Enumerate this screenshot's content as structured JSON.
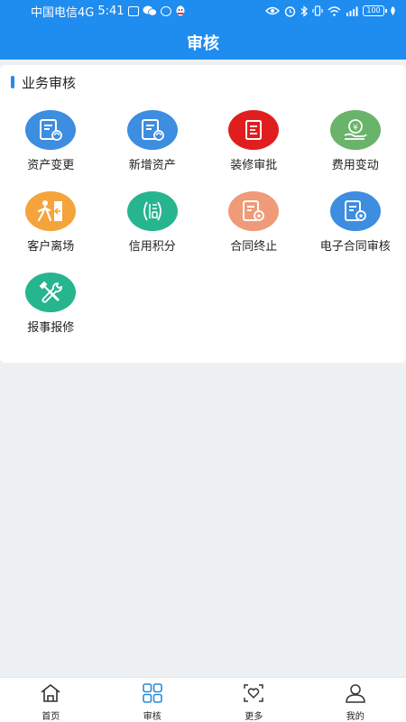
{
  "status_bar": {
    "carrier": "中国电信4G",
    "time": "5:41",
    "battery": "100"
  },
  "header": {
    "title": "审核"
  },
  "section": {
    "title": "业务审核"
  },
  "tiles": [
    {
      "label": "资产变更",
      "icon": "asset-change-icon",
      "color": "#3d8de0"
    },
    {
      "label": "新增资产",
      "icon": "add-asset-icon",
      "color": "#3d8de0"
    },
    {
      "label": "装修审批",
      "icon": "renovation-icon",
      "color": "#e01e1e"
    },
    {
      "label": "费用变动",
      "icon": "fee-change-icon",
      "color": "#69b36a"
    },
    {
      "label": "客户离场",
      "icon": "customer-exit-icon",
      "color": "#f4a43a"
    },
    {
      "label": "信用积分",
      "icon": "credit-icon",
      "color": "#26b58f"
    },
    {
      "label": "合同终止",
      "icon": "contract-end-icon",
      "color": "#ef9a78"
    },
    {
      "label": "电子合同审核",
      "icon": "e-contract-icon",
      "color": "#3d8de0"
    },
    {
      "label": "报事报修",
      "icon": "repair-icon",
      "color": "#26b58f"
    }
  ],
  "tabbar": [
    {
      "label": "首页",
      "icon": "home-icon",
      "active": false
    },
    {
      "label": "审核",
      "icon": "grid-icon",
      "active": true
    },
    {
      "label": "更多",
      "icon": "heart-scan-icon",
      "active": false
    },
    {
      "label": "我的",
      "icon": "user-icon",
      "active": false
    }
  ],
  "colors": {
    "primary": "#1f8cf0",
    "active_tab": "#2a8bd8"
  }
}
